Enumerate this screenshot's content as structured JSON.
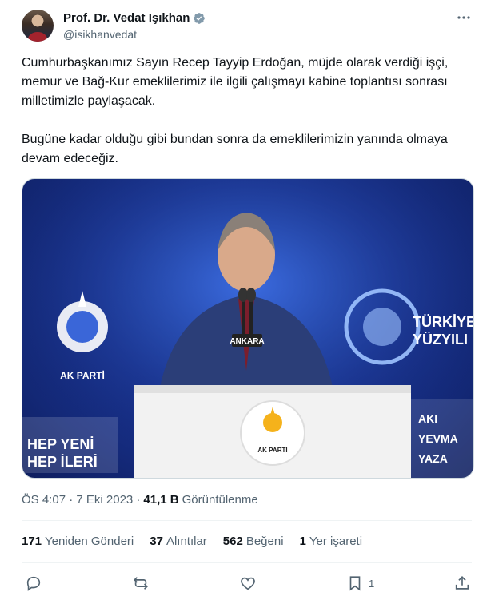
{
  "user": {
    "display_name": "Prof. Dr. Vedat Işıkhan",
    "handle": "@isikhanvedat"
  },
  "tweet": {
    "text": "Cumhurbaşkanımız Sayın Recep Tayyip Erdoğan, müjde olarak verdiği işçi, memur ve Bağ-Kur emeklilerimiz ile ilgili çalışmayı kabine toplantısı sonrası milletimizle paylaşacak.\n\nBugüne kadar olduğu gibi bundan sonra da emeklilerimizin yanında olmaya devam edeceğiz.",
    "time": "ÖS 4:07 · 7 Eki 2023 ·",
    "views_count": "41,1 B",
    "views_label": "Görüntülenme"
  },
  "media": {
    "podium_label": "ANKARA",
    "left_logo_text": "AK PARTİ",
    "podium_logo_text": "AK PARTİ",
    "banner_left_1": "HEP YENİ",
    "banner_left_2": "HEP İLERİ",
    "banner_right_1": "TÜRKİYE",
    "banner_right_2": "YÜZYILI",
    "right_tags": [
      "AKI",
      "YEVMA",
      "YAZA"
    ],
    "colors": {
      "background": "#1a3596",
      "podium": "#f2f2f2",
      "accent": "#ffffff"
    }
  },
  "stats": {
    "retweets_count": "171",
    "retweets_label": "Yeniden Gönderi",
    "quotes_count": "37",
    "quotes_label": "Alıntılar",
    "likes_count": "562",
    "likes_label": "Beğeni",
    "bookmarks_count": "1",
    "bookmarks_label": "Yer işareti"
  },
  "actions": {
    "reply_icon": "reply-icon",
    "retweet_icon": "retweet-icon",
    "like_icon": "heart-icon",
    "bookmark_icon": "bookmark-icon",
    "bookmark_count": "1",
    "share_icon": "share-icon"
  },
  "colors": {
    "verified": "#829aab",
    "text": "#0f1419",
    "muted": "#536471"
  }
}
